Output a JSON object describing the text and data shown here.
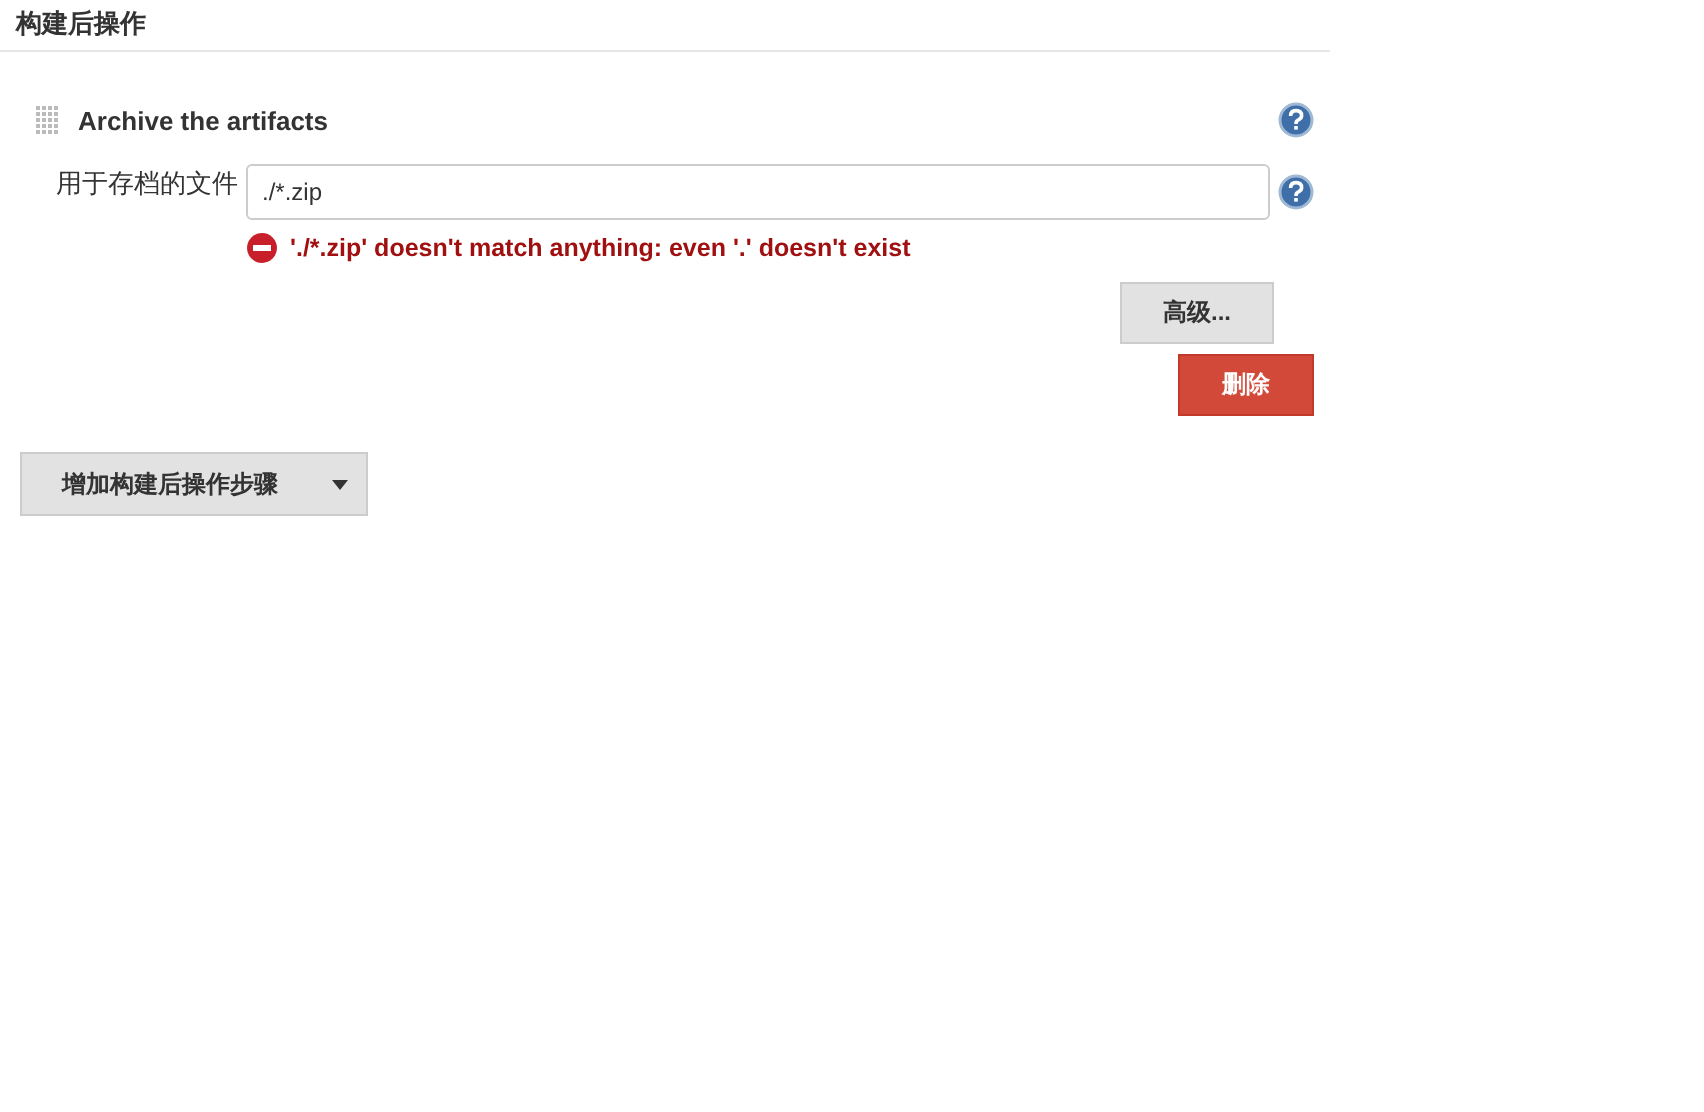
{
  "section": {
    "title": "构建后操作"
  },
  "step": {
    "title": "Archive the artifacts",
    "field": {
      "label": "用于存档的文件",
      "value": "./*.zip"
    },
    "error": "'./*.zip' doesn't match anything: even '.' doesn't exist",
    "buttons": [
      {
        "label": "高级...",
        "kind": "advanced"
      },
      {
        "label": "删除",
        "kind": "delete"
      }
    ]
  },
  "add_button": {
    "label": "增加构建后操作步骤"
  }
}
